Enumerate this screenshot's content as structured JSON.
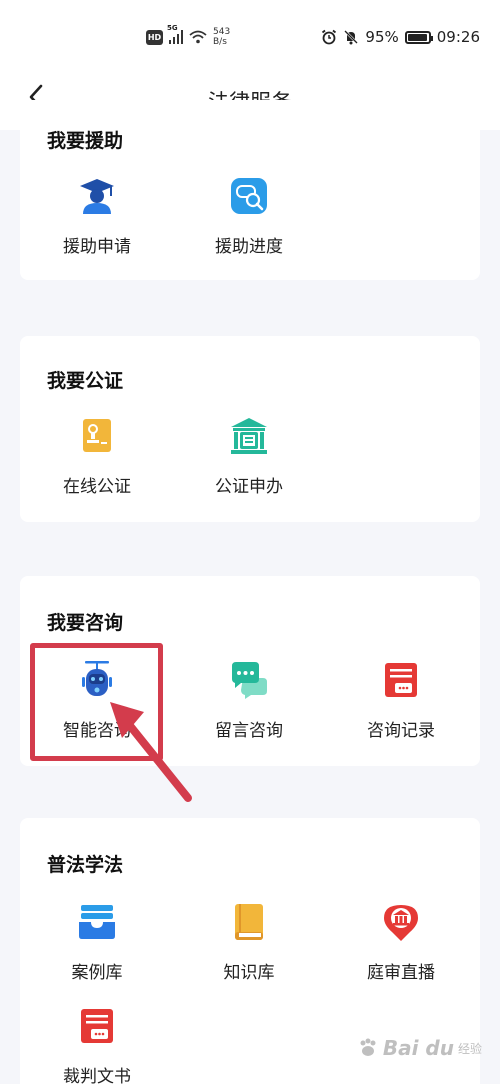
{
  "status_bar": {
    "hd": "HD",
    "network_type": "5G",
    "speed_value": "543",
    "speed_unit": "B/s",
    "battery": "95%",
    "battery_level": 0.95,
    "time": "09:26"
  },
  "nav": {
    "title": "法律服务"
  },
  "sections": {
    "aid": {
      "title": "我要援助",
      "items": [
        "援助申请",
        "援助进度"
      ]
    },
    "notary": {
      "title": "我要公证",
      "items": [
        "在线公证",
        "公证申办"
      ]
    },
    "consult": {
      "title": "我要咨询",
      "items": [
        "智能咨询",
        "留言咨询",
        "咨询记录"
      ]
    },
    "learn": {
      "title": "普法学法",
      "items": [
        "案例库",
        "知识库",
        "庭审直播",
        "裁判文书"
      ]
    }
  },
  "watermark": {
    "brand": "Bai du",
    "sub": "经验"
  },
  "colors": {
    "blue": "#2b7be4",
    "green": "#24b89a",
    "red": "#e53935",
    "yellow": "#f2b63a",
    "highlight": "#d33c4c"
  }
}
